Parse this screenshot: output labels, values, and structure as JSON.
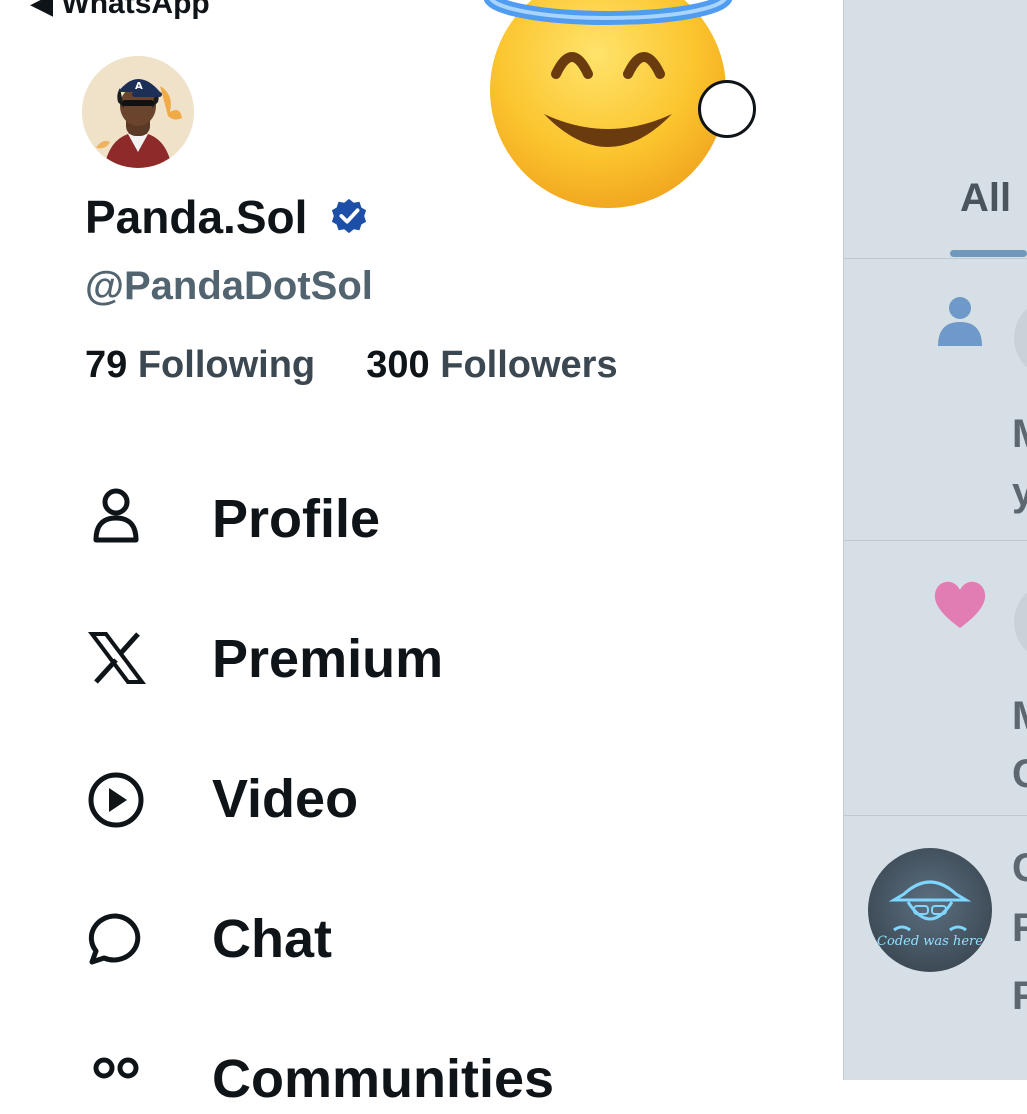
{
  "status_bar": {
    "back_label": "◀ WhatsApp"
  },
  "profile": {
    "display_name": "Panda.Sol",
    "handle": "@PandaDotSol",
    "following_count": "79",
    "following_label": "Following",
    "followers_count": "300",
    "followers_label": "Followers",
    "verified": true
  },
  "menu": {
    "items": [
      {
        "label": "Profile",
        "icon": "person-icon"
      },
      {
        "label": "Premium",
        "icon": "x-logo-icon"
      },
      {
        "label": "Video",
        "icon": "play-circle-icon"
      },
      {
        "label": "Chat",
        "icon": "chat-bubble-icon"
      },
      {
        "label": "Communities",
        "icon": "communities-icon"
      }
    ]
  },
  "notifications_panel": {
    "tab_all": "All",
    "avatar_caption": "Coded was here"
  },
  "colors": {
    "text_primary": "#0f1419",
    "text_secondary": "#536471",
    "verified_blue": "#1d4fa8",
    "panel_overlay": "#d6dfe6",
    "heart_pink": "#e27db3"
  }
}
